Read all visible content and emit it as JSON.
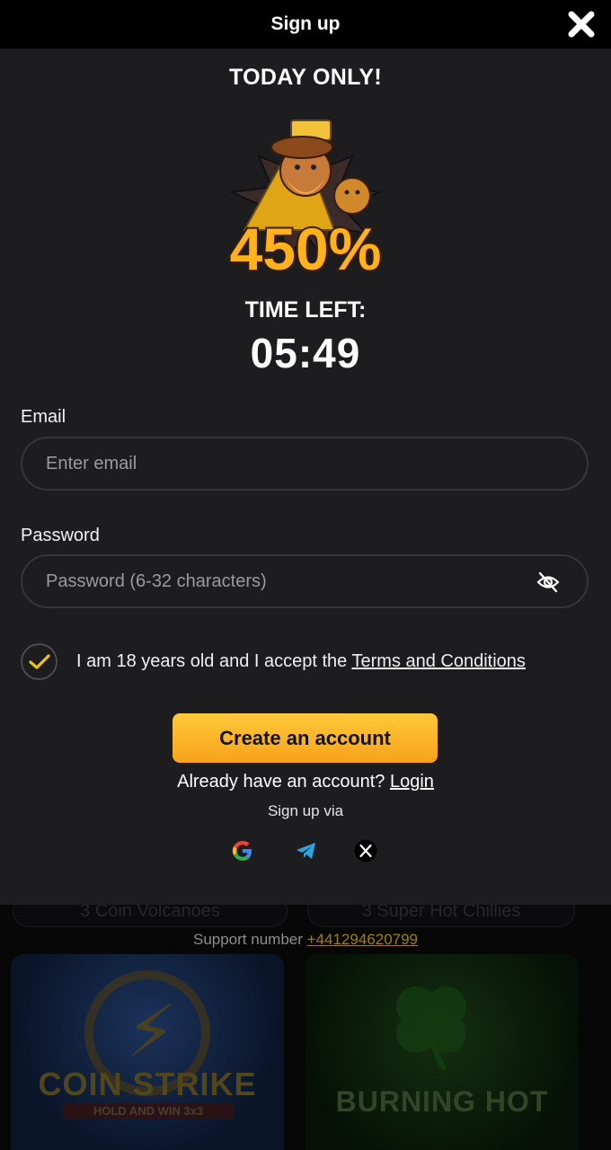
{
  "background": {
    "pills": [
      "3 Coin Volcanoes",
      "3 Super Hot Chillies"
    ],
    "support_label": "Support number",
    "support_number": "+441294620799",
    "games": [
      {
        "title": "COIN STRIKE",
        "subtitle": "HOLD AND WIN 3x3"
      },
      {
        "title": "BURNING HOT"
      }
    ]
  },
  "modal": {
    "title": "Sign up",
    "promo_title": "TODAY ONLY!",
    "bonus_percent": "450%",
    "time_left_label": "TIME LEFT:",
    "timer": "05:49",
    "email": {
      "label": "Email",
      "placeholder": "Enter email",
      "value": ""
    },
    "password": {
      "label": "Password",
      "placeholder": "Password (6-32 characters)",
      "value": ""
    },
    "terms": {
      "checked": true,
      "text": "I am 18 years old and I accept the",
      "link": "Terms and Conditions"
    },
    "cta_label": "Create an account",
    "have_account_text": "Already have an account?",
    "login_link": "Login",
    "signup_via": "Sign up via",
    "social": [
      "google-icon",
      "telegram-icon",
      "x-icon"
    ]
  },
  "colors": {
    "accent": "#ffc83a",
    "accent_dark": "#f7a21a",
    "check": "#f2c500",
    "modal_bg": "#1d1d1f",
    "header_bg": "#000000"
  }
}
